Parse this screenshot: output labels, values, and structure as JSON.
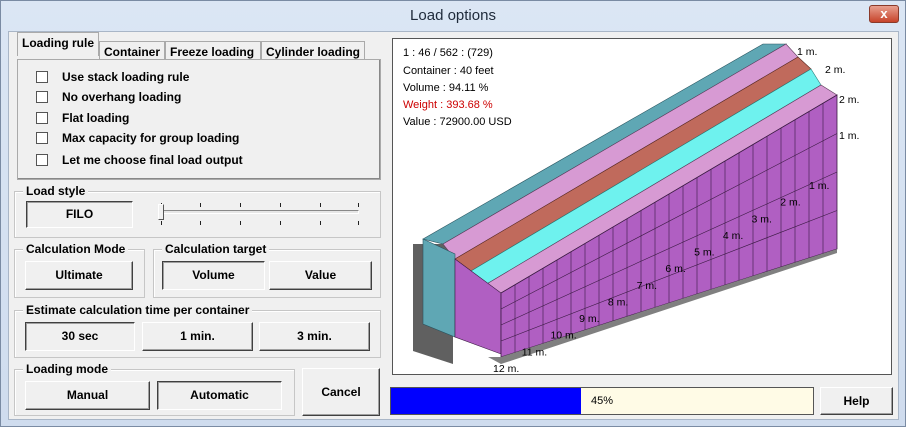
{
  "window": {
    "title": "Load options",
    "close_glyph": "x"
  },
  "tabs": [
    {
      "label": "Loading rule",
      "active": true
    },
    {
      "label": "Container",
      "active": false
    },
    {
      "label": "Freeze loading",
      "active": false
    },
    {
      "label": "Cylinder loading",
      "active": false
    }
  ],
  "rules": [
    {
      "label": "Use stack loading rule",
      "checked": false
    },
    {
      "label": "No overhang loading",
      "checked": false
    },
    {
      "label": "Flat loading",
      "checked": false
    },
    {
      "label": "Max capacity for group loading",
      "checked": false
    },
    {
      "label": "Let me choose final load output",
      "checked": false
    }
  ],
  "load_style": {
    "group_label": "Load style",
    "value": "FILO",
    "slider_level": 0
  },
  "calc_mode": {
    "group_label": "Calculation Mode",
    "value": "Ultimate"
  },
  "calc_target": {
    "group_label": "Calculation target",
    "options": [
      "Volume",
      "Value"
    ],
    "selected": "Volume"
  },
  "estimate": {
    "group_label": "Estimate calculation time per container",
    "options": [
      "30 sec",
      "1 min.",
      "3 min."
    ],
    "selected": "30 sec"
  },
  "loading_mode": {
    "group_label": "Loading mode",
    "options": [
      "Manual",
      "Automatic"
    ],
    "selected": "Automatic"
  },
  "cancel_label": "Cancel",
  "help_label": "Help",
  "info": {
    "line1": "1 : 46 / 562 : (729)",
    "container": "Container : 40 feet",
    "volume": "Volume : 94.11 %",
    "weight": "Weight : 393.68 %",
    "value": "Value : 72900.00 USD",
    "weight_color": "#cc0000"
  },
  "dimensions": {
    "top_right": [
      "1 m.",
      "2 m.",
      "2 m.",
      "1 m."
    ],
    "length": [
      "1 m.",
      "2 m.",
      "3 m.",
      "4 m.",
      "5 m.",
      "6 m.",
      "7 m.",
      "8 m.",
      "9 m.",
      "10 m.",
      "11 m.",
      "12 m."
    ]
  },
  "colors": {
    "teal": "#5fa7b4",
    "pink": "#d79ad3",
    "brick": "#c06a5c",
    "cyan": "#6ef2ee",
    "purple": "#b05fc2",
    "progress_fill": "#0000ff",
    "progress_bg": "#fffbe6"
  },
  "progress": {
    "percent": 45,
    "label": "45%"
  }
}
